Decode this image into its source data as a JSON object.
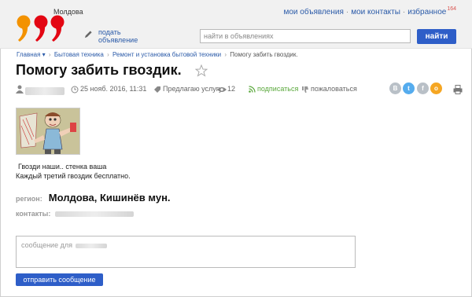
{
  "header": {
    "region": "Молдова",
    "links": [
      "мои объявления",
      "мои контакты",
      "избранное"
    ],
    "favorites_count": "164",
    "post_ad_label": "подать объявление",
    "search_placeholder": "найти в объявлениях",
    "search_button": "найти"
  },
  "breadcrumb": [
    "Главная ▾",
    "Бытовая техника",
    "Ремонт и установка бытовой техники",
    "Помогу забить гвоздик."
  ],
  "ad": {
    "title": "Помогу забить гвоздик.",
    "date": "25 нояб. 2016, 11:31",
    "offer_type": "Предлагаю услугу",
    "views": "12",
    "subscribe": "подписаться",
    "complain": "пожаловаться",
    "description_lines": [
      "Гвозди наши.. стенка ваша",
      "Каждый третий гвоздик бесплатно."
    ],
    "region_label": "регион:",
    "region_value": "Молдова, Кишинёв мун.",
    "contacts_label": "контакты:"
  },
  "social": [
    {
      "letter": "В",
      "color": "#b9c0c7"
    },
    {
      "letter": "t",
      "color": "#55acee"
    },
    {
      "letter": "f",
      "color": "#b9c0c7"
    },
    {
      "letter": "о",
      "color": "#f5a623"
    }
  ],
  "message": {
    "placeholder": "сообщение для",
    "send_button": "отправить сообщение"
  },
  "colors": {
    "accent": "#2e5ec8",
    "link": "#2a5aa8",
    "logo_orange": "#f39200",
    "logo_red": "#e30613"
  }
}
